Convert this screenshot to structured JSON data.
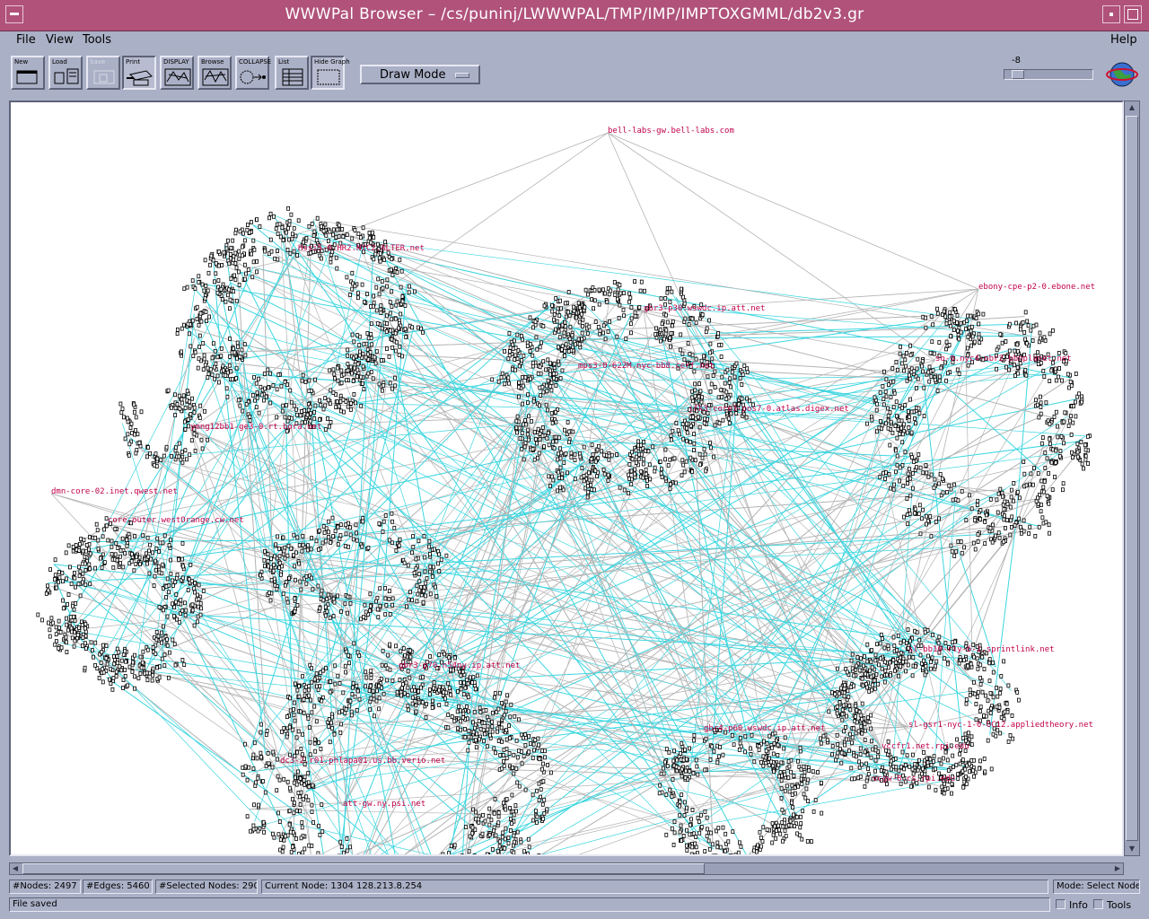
{
  "window": {
    "title": "WWWPal Browser – /cs/puninj/LWWWPAL/TMP/IMP/IMPTOXGMML/db2v3.gr"
  },
  "menu": {
    "file": "File",
    "view": "View",
    "tools": "Tools",
    "help": "Help"
  },
  "toolbar": {
    "new": "New",
    "load": "Load",
    "save": "Save",
    "print": "Print",
    "display": "DISPLAY",
    "browse": "Browse",
    "collapse": "COLLAPSE",
    "list": "List",
    "hide_graph": "Hide Graph",
    "mode": "Draw Mode",
    "zoom": "-8"
  },
  "graph": {
    "labels": [
      "bell-labs-gw.bell-labs.com",
      "Hssi5-0.HR2.NYC2.ALTER.net",
      "gbr3-p30.wswdc.ip.att.net",
      "ebony-cpe-p2-0.ebone.net",
      "so-0.nyc4-nbr2.bbnplanet.net",
      "mps3-0-622M.nyc-bb8.cerf.net",
      "jfk3-core3-pos7-0.atlas.digex.net",
      "ymng12bb1-ge3-0.rt.bora.net",
      "dmn-core-02.inet.qwest.net",
      "core-outer.westOrange.cw.net",
      "sl-bb10-rly-6-1.sprintlink.net",
      "gbr3-p70.n54ny.ip.att.net",
      "sl-gsr1-nyc-1-0-OC12.appliedtheory.net",
      "gbr4-p60.wswdc.ip.att.net",
      "vccfr1.net.rpi.edu",
      "dc3-2.r01.phlapa01.us.bb.verio.net",
      "vcgw-8.cs.rpi.edu",
      "att-gw.ny.psi.net"
    ]
  },
  "status": {
    "nodes": "#Nodes: 2497",
    "edges": "#Edges: 5460",
    "selected": "#Selected Nodes: 290",
    "current": "Current Node: 1304 128.213.8.254",
    "mode": "Mode: Select Node",
    "message": "File saved",
    "info": "Info",
    "tools": "Tools"
  },
  "colors": {
    "titlebar": "#b0527a",
    "chrome": "#aab0c6",
    "edge_highlight": "#3cd6e0",
    "edge_normal": "#b4b4b4",
    "label": "#c0004a"
  }
}
